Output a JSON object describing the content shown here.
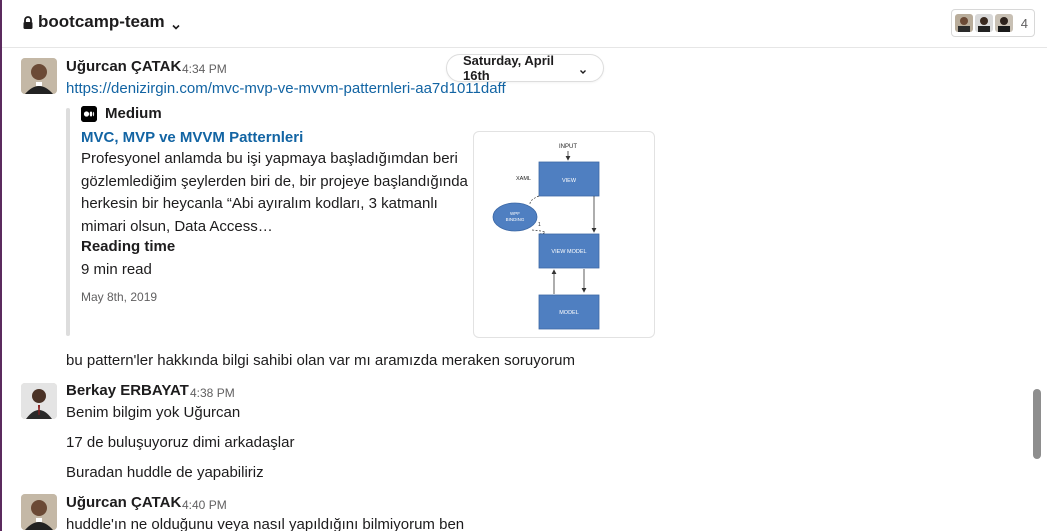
{
  "header": {
    "channel_name": "bootcamp-team",
    "member_count": "4"
  },
  "date_divider": {
    "label": "Saturday, April 16th"
  },
  "messages": [
    {
      "sender": "Uğurcan ÇATAK",
      "time": "4:34 PM",
      "link": "https://denizirgin.com/mvc-mvp-ve-mvvm-patternleri-aa7d1011daff",
      "unfurl": {
        "service": "Medium",
        "title": "MVC, MVP ve MVVM Patternleri",
        "description_lines": [
          "Profesyonel anlamda bu işi yapmaya başladığımdan beri",
          "gözlemlediğim şeylerden biri de, bir projeye başlandığında",
          "herkesin bir heycanla “Abi ayıralım kodları, 3 katmanlı",
          "mimari olsun, Data Access…"
        ],
        "field_label": "Reading time",
        "field_value": "9 min read",
        "date": "May 8th, 2019",
        "diagram": {
          "input": "INPUT",
          "xaml": "XAML",
          "view": "VIEW",
          "binding_line1": "WPF",
          "binding_line2": "BINDING",
          "viewmodel": "VIEW MODEL",
          "model": "MODEL",
          "edge_label": "1"
        }
      },
      "followup": "bu pattern'ler hakkında bilgi sahibi olan var mı aramızda meraken soruyorum"
    },
    {
      "sender": "Berkay ERBAYAT",
      "time": "4:38 PM",
      "lines": [
        "Benim bilgim yok Uğurcan",
        "17 de buluşuyoruz dimi arkadaşlar",
        "Buradan huddle de yapabiliriz"
      ]
    },
    {
      "sender": "Uğurcan ÇATAK",
      "time": "4:40 PM",
      "lines": [
        "huddle'ın ne olduğunu veya nasıl yapıldığını bilmiyorum ben"
      ]
    }
  ],
  "colors": {
    "link": "#1264a3",
    "diagram_box": "#4f7fc1",
    "sidebar_accent": "#5b2a5e"
  }
}
